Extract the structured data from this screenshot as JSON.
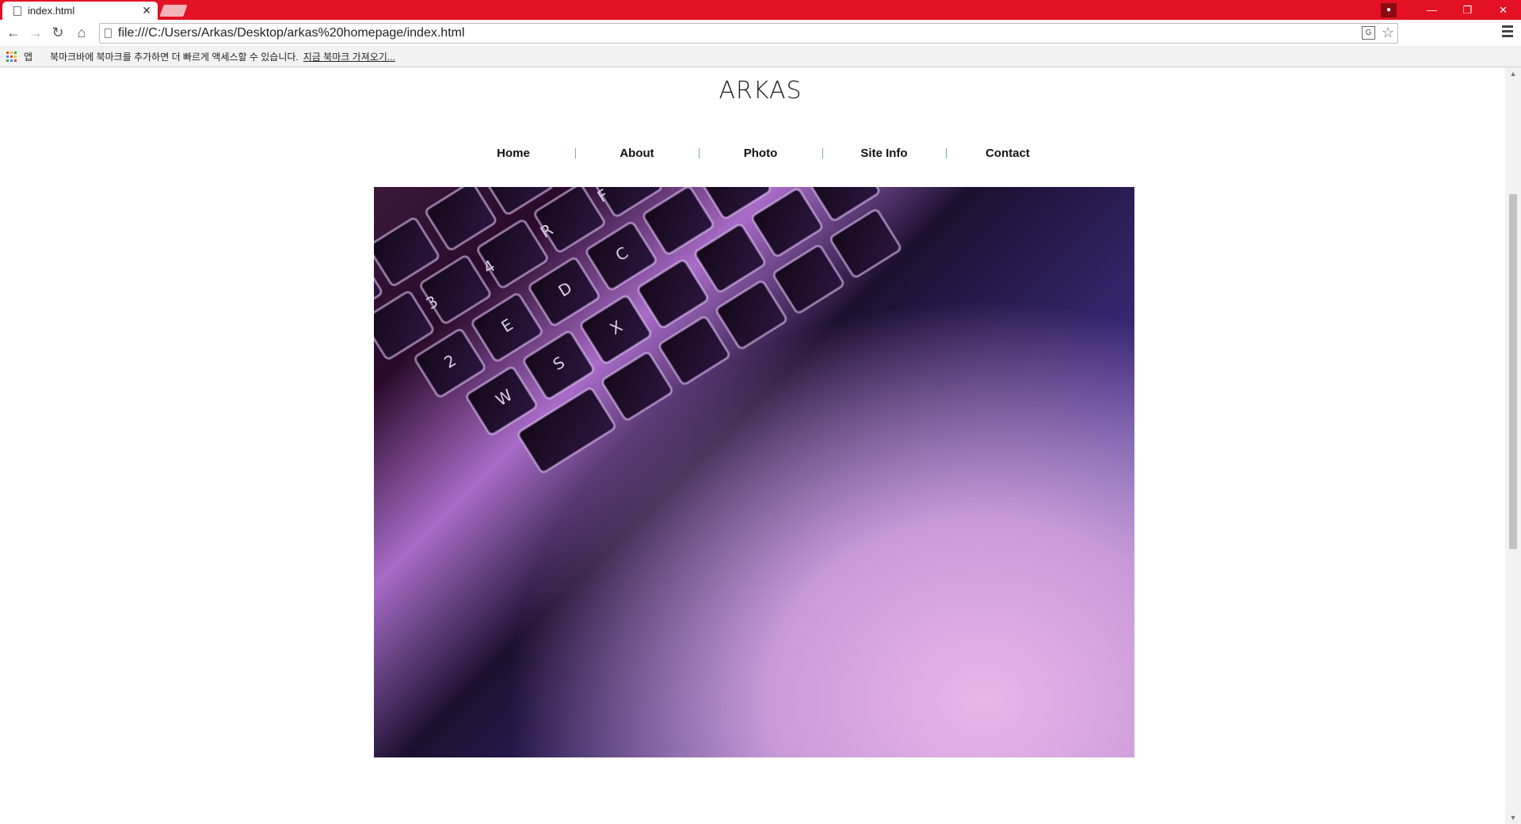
{
  "browser": {
    "tab_title": "index.html",
    "url": "file:///C:/Users/Arkas/Desktop/arkas%20homepage/index.html",
    "bookmark_apps_label": "앱",
    "bookmark_message": "북마크바에 북마크를 추가하면 더 빠르게 액세스할 수 있습니다.",
    "bookmark_import_link": "지금 북마크 가져오기..."
  },
  "site": {
    "logo": "ARKAS",
    "nav": [
      "Home",
      "About",
      "Photo",
      "Site Info",
      "Contact"
    ]
  },
  "hero": {
    "image_alt": "backlit laptop keyboard"
  },
  "colors": {
    "titlebar": "#e31123",
    "accent_dark": "#8a0a14",
    "nav_divider": "#77aaaa"
  }
}
